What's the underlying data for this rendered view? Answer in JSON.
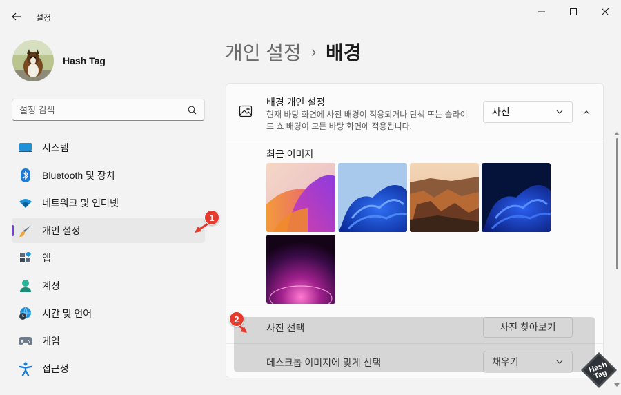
{
  "window": {
    "title": "설정"
  },
  "profile": {
    "name": "Hash Tag"
  },
  "search": {
    "placeholder": "설정 검색"
  },
  "sidebar": {
    "items": [
      {
        "label": "시스템",
        "icon": "system-icon"
      },
      {
        "label": "Bluetooth 및 장치",
        "icon": "bluetooth-icon"
      },
      {
        "label": "네트워크 및 인터넷",
        "icon": "wifi-icon"
      },
      {
        "label": "개인 설정",
        "icon": "brush-icon",
        "selected": true
      },
      {
        "label": "앱",
        "icon": "apps-icon"
      },
      {
        "label": "계정",
        "icon": "account-icon"
      },
      {
        "label": "시간 및 언어",
        "icon": "globe-clock-icon"
      },
      {
        "label": "게임",
        "icon": "gamepad-icon"
      },
      {
        "label": "접근성",
        "icon": "accessibility-icon"
      }
    ]
  },
  "breadcrumb": {
    "parent": "개인 설정",
    "separator": "›",
    "current": "배경"
  },
  "background": {
    "title": "배경 개인 설정",
    "description": "현재 바탕 화면에 사진 배경이 적용되거나 단색 또는 슬라이드 쇼 배경이 모든 바탕 화면에 적용됩니다.",
    "type_value": "사진",
    "recent_label": "최근 이미지",
    "choose_photo_label": "사진 선택",
    "browse_button": "사진 찾아보기",
    "fit_label": "데스크톱 이미지에 맞게 선택",
    "fit_value": "채우기"
  },
  "annotations": {
    "badge1": "1",
    "badge2": "2"
  },
  "logo": {
    "line1": "Hash",
    "line2": "Tag"
  },
  "colors": {
    "accent": "#7a3bd6",
    "badge": "#e53a2c"
  }
}
